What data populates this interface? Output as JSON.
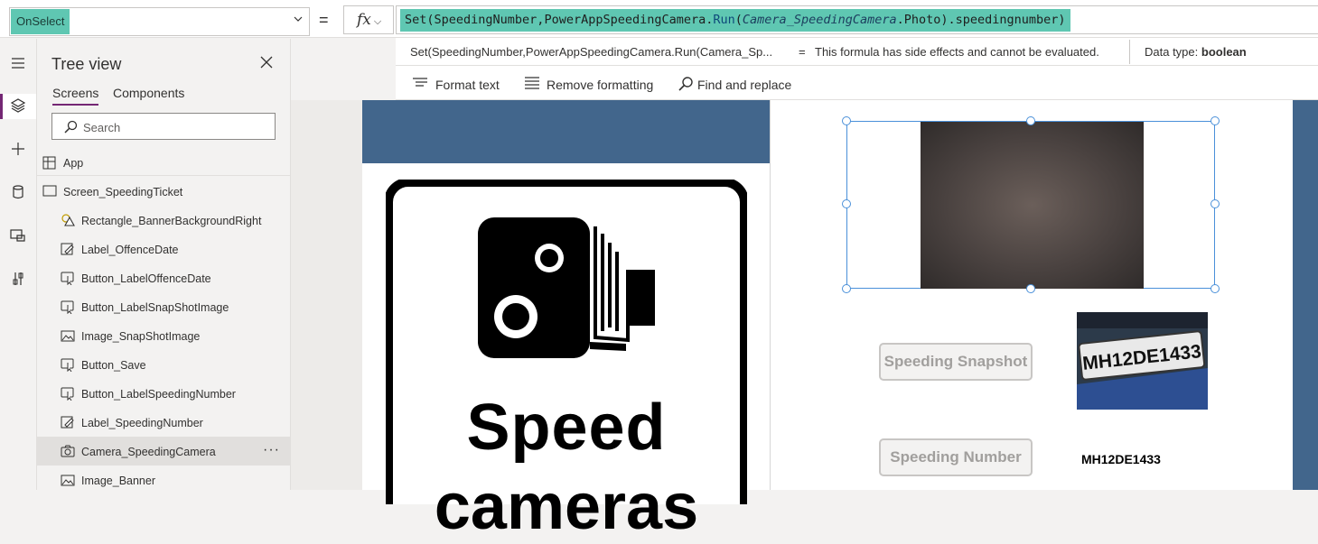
{
  "formula_bar": {
    "property": "OnSelect",
    "equals": "=",
    "fx": "fx",
    "formula": {
      "p1": "Set(SpeedingNumber,",
      "p2": "PowerAppSpeedingCamera",
      "p3": ".",
      "p4": "Run",
      "p5": "(",
      "p6": "Camera_SpeedingCamera",
      "p7": ".Photo).speedingnumber)"
    }
  },
  "eval_bar": {
    "expression": "Set(SpeedingNumber,PowerAppSpeedingCamera.Run(Camera_Sp...",
    "equals": "=",
    "message": "This formula has side effects and cannot be evaluated.",
    "data_type_label": "Data type:",
    "data_type_value": "boolean"
  },
  "format_bar": {
    "format_text": "Format text",
    "remove_formatting": "Remove formatting",
    "find_replace": "Find and replace"
  },
  "tree_view": {
    "title": "Tree view",
    "tabs": [
      "Screens",
      "Components"
    ],
    "search_placeholder": "Search",
    "app_label": "App",
    "screen_label": "Screen_SpeedingTicket",
    "items": [
      {
        "label": "Rectangle_BannerBackgroundRight",
        "icon": "shapes-icon"
      },
      {
        "label": "Label_OffenceDate",
        "icon": "label-icon"
      },
      {
        "label": "Button_LabelOffenceDate",
        "icon": "button-icon"
      },
      {
        "label": "Button_LabelSnapShotImage",
        "icon": "button-icon"
      },
      {
        "label": "Image_SnapShotImage",
        "icon": "image-icon"
      },
      {
        "label": "Button_Save",
        "icon": "button-icon"
      },
      {
        "label": "Button_LabelSpeedingNumber",
        "icon": "button-icon"
      },
      {
        "label": "Label_SpeedingNumber",
        "icon": "label-icon"
      },
      {
        "label": "Camera_SpeedingCamera",
        "icon": "camera-icon",
        "selected": true
      },
      {
        "label": "Image_Banner",
        "icon": "image-icon"
      }
    ],
    "more": "···"
  },
  "canvas": {
    "sign_line1": "Speed",
    "sign_line2": "cameras",
    "snapshot_button": "Speeding Snapshot",
    "number_button": "Speeding Number",
    "plate_text": "MH12DE1433",
    "speeding_number": "MH12DE1433"
  },
  "colors": {
    "accent": "#742774",
    "formula_highlight": "#5fc7b2",
    "banner": "#42668c",
    "selection": "#4a90d9"
  }
}
